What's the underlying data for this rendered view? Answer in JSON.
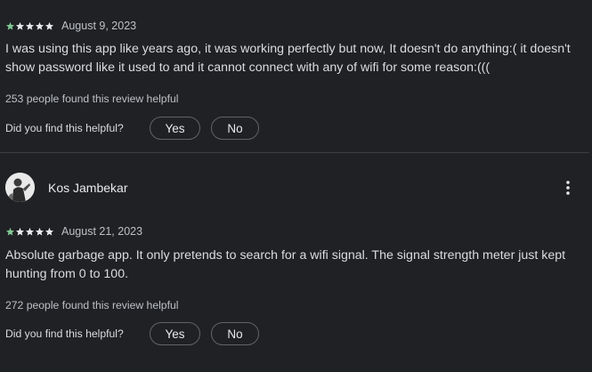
{
  "colors": {
    "background": "#202124",
    "star": "#81c995",
    "text_primary": "#e8eaed",
    "text_secondary": "#bdc1c6",
    "divider": "#3c4043",
    "pill_border": "#5f6368"
  },
  "reviews": [
    {
      "author": "",
      "rating": 5,
      "date": "August 9, 2023",
      "text": "I was using this app like years ago, it was working perfectly but now, It doesn't do anything:( it doesn't show password like it used to and it cannot connect with any of wifi for some reason:(((",
      "helpful_count_text": "253 people found this review helpful",
      "feedback_prompt": "Did you find this helpful?",
      "yes_label": "Yes",
      "no_label": "No"
    },
    {
      "author": "Kos Jambekar",
      "avatar_icon": "user-photo-avatar",
      "menu_icon": "more-vert-icon",
      "rating": 5,
      "date": "August 21, 2023",
      "text": "Absolute garbage app. It only pretends to search for a wifi signal. The signal strength meter just kept hunting from 0 to 100.",
      "helpful_count_text": "272 people found this review helpful",
      "feedback_prompt": "Did you find this helpful?",
      "yes_label": "Yes",
      "no_label": "No"
    }
  ]
}
